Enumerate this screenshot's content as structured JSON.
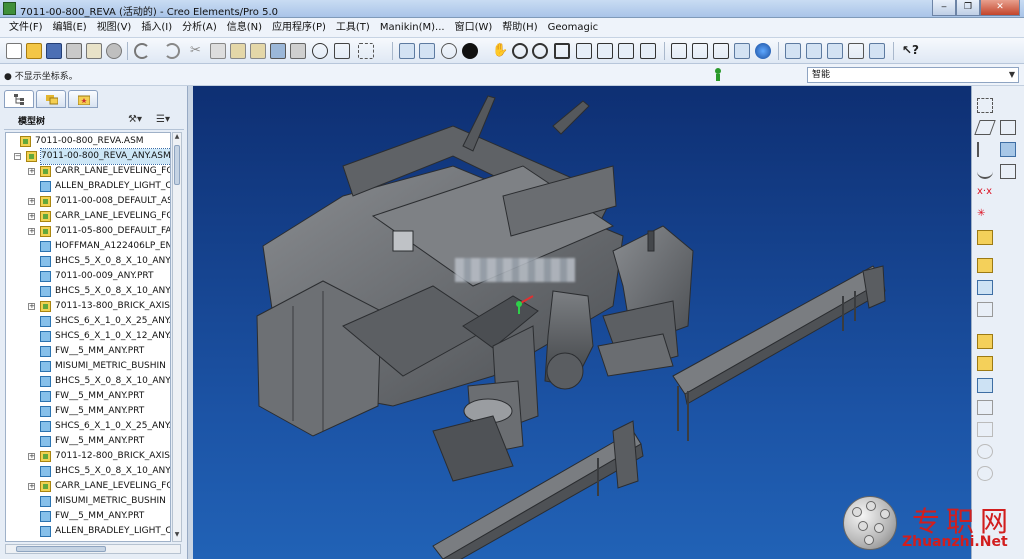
{
  "window": {
    "title": "7011-00-800_REVA (活动的) - Creo Elements/Pro 5.0"
  },
  "menu": [
    "文件(F)",
    "编辑(E)",
    "视图(V)",
    "插入(I)",
    "分析(A)",
    "信息(N)",
    "应用程序(P)",
    "工具(T)",
    "Manikin(M)...",
    "窗口(W)",
    "帮助(H)",
    "Geomagic"
  ],
  "message": "● 不显示坐标系。",
  "filter_select": {
    "value": "智能"
  },
  "panel": {
    "title": "模型树",
    "tabs": [
      "model-tree-tab",
      "layer-tab",
      "favorites-tab"
    ]
  },
  "tree": [
    {
      "label": "7011-00-800_REVA.ASM",
      "type": "asm",
      "level": 0,
      "exp": ""
    },
    {
      "label": "7011-00-800_REVA_ANY.ASM",
      "type": "asm",
      "level": 1,
      "exp": "−",
      "selected": true
    },
    {
      "label": "CARR_LANE_LEVELING_FC",
      "type": "asm",
      "level": 2,
      "exp": "+"
    },
    {
      "label": "ALLEN_BRADLEY_LIGHT_C",
      "type": "prt",
      "level": 2,
      "exp": ""
    },
    {
      "label": "7011-00-008_DEFAULT_AS",
      "type": "asm",
      "level": 2,
      "exp": "+"
    },
    {
      "label": "CARR_LANE_LEVELING_FC",
      "type": "asm",
      "level": 2,
      "exp": "+"
    },
    {
      "label": "7011-05-800_DEFAULT_FA",
      "type": "asm",
      "level": 2,
      "exp": "+"
    },
    {
      "label": "HOFFMAN_A122406LP_EN",
      "type": "prt",
      "level": 2,
      "exp": ""
    },
    {
      "label": "BHCS_5_X_0_8_X_10_ANY.F",
      "type": "prt",
      "level": 2,
      "exp": ""
    },
    {
      "label": "7011-00-009_ANY.PRT",
      "type": "prt",
      "level": 2,
      "exp": ""
    },
    {
      "label": "BHCS_5_X_0_8_X_10_ANY.F",
      "type": "prt",
      "level": 2,
      "exp": ""
    },
    {
      "label": "7011-13-800_BRICK_AXIS_",
      "type": "asm",
      "level": 2,
      "exp": "+"
    },
    {
      "label": "SHCS_6_X_1_0_X_25_ANY.F",
      "type": "prt",
      "level": 2,
      "exp": ""
    },
    {
      "label": "SHCS_6_X_1_0_X_12_ANY.F",
      "type": "prt",
      "level": 2,
      "exp": ""
    },
    {
      "label": "FW__5_MM_ANY.PRT",
      "type": "prt",
      "level": 2,
      "exp": ""
    },
    {
      "label": "MISUMI_METRIC_BUSHIN",
      "type": "prt",
      "level": 2,
      "exp": ""
    },
    {
      "label": "BHCS_5_X_0_8_X_10_ANY.F",
      "type": "prt",
      "level": 2,
      "exp": ""
    },
    {
      "label": "FW__5_MM_ANY.PRT",
      "type": "prt",
      "level": 2,
      "exp": ""
    },
    {
      "label": "FW__5_MM_ANY.PRT",
      "type": "prt",
      "level": 2,
      "exp": ""
    },
    {
      "label": "SHCS_6_X_1_0_X_25_ANY.F",
      "type": "prt",
      "level": 2,
      "exp": ""
    },
    {
      "label": "FW__5_MM_ANY.PRT",
      "type": "prt",
      "level": 2,
      "exp": ""
    },
    {
      "label": "7011-12-800_BRICK_AXIS_",
      "type": "asm",
      "level": 2,
      "exp": "+"
    },
    {
      "label": "BHCS_5_X_0_8_X_10_ANY.F",
      "type": "prt",
      "level": 2,
      "exp": ""
    },
    {
      "label": "CARR_LANE_LEVELING_FC",
      "type": "asm",
      "level": 2,
      "exp": "+"
    },
    {
      "label": "MISUMI_METRIC_BUSHIN",
      "type": "prt",
      "level": 2,
      "exp": ""
    },
    {
      "label": "FW__5_MM_ANY.PRT",
      "type": "prt",
      "level": 2,
      "exp": ""
    },
    {
      "label": "ALLEN_BRADLEY_LIGHT_C",
      "type": "prt",
      "level": 2,
      "exp": ""
    }
  ],
  "watermark": {
    "cn": "专职网",
    "en": "Zhuanzhi.Net"
  },
  "colors": {
    "viewport_top": "#0e2f73",
    "viewport_bottom": "#2162b6",
    "model_gray": "#6f7276",
    "watermark_red": "#d21e1e"
  }
}
